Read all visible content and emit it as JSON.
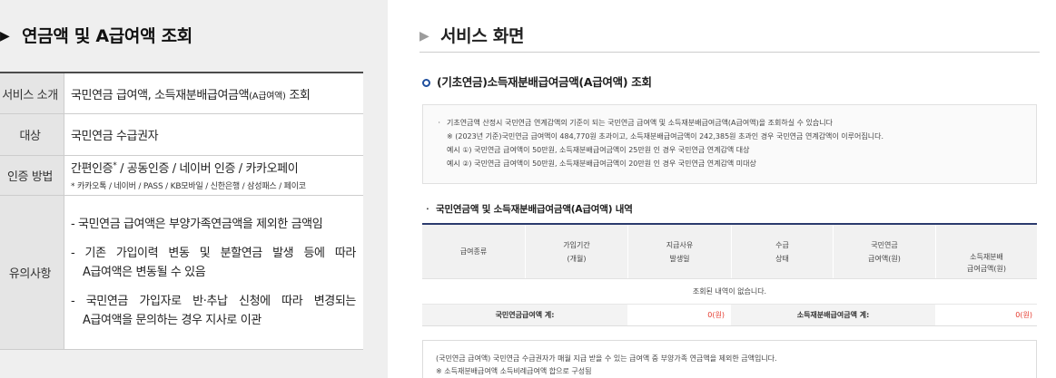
{
  "left": {
    "title_arrow": "▶",
    "title": "연금액 및 A급여액 조회",
    "table": {
      "intro": {
        "header": "서비스 소개",
        "text": "국민연금 급여액, 소득재분배급여금액",
        "text_small": "(A급여액)",
        "text_tail": "조회"
      },
      "target": {
        "header": "대상",
        "text": "국민연금 수급권자"
      },
      "auth": {
        "header": "인증 방법",
        "text": "간편인증",
        "mark": "*",
        "text_rest": " / 공동인증 / 네이버 인증 / 카카오페이",
        "note": "* 카카오톡 / 네이버 / PASS / KB모바일 / 신한은행 / 삼성패스 / 페이코"
      },
      "notes": {
        "header": "유의사항",
        "items": [
          {
            "lines": [
              "- 국민연금 급여액은 부양가족연금액을 제외한 금액임"
            ]
          },
          {
            "lines": [
              "- 기존 가입이력 변동 및 분할연금 발생 등에 따라",
              "A급여액은 변동될 수 있음"
            ]
          },
          {
            "lines": [
              "- 국민연금 가입자로 반·추납 신청에 따라 변경되는",
              "A급여액을 문의하는 경우 지사로 이관"
            ]
          }
        ]
      }
    }
  },
  "right": {
    "title_arrow": "▶",
    "title": "서비스 화면",
    "section1_title": "(기초연금)소득재분배급여금액(A급여액) 조회",
    "info_box": {
      "bullet": "ㆍ",
      "lines": [
        "기초연금액 산정시 국민연금 연계감액의 기준이 되는 국민연금 급여액 및 소득재분배급여금액(A급여액)을 조회하실 수 있습니다",
        "※ (2023년 기준)국민연금 급여액이 484,770원 초과이고, 소득재분배급여금액이 242,385원 초과인 경우 국민연금 연계감액이 이루어집니다.",
        "예시 ①) 국민연금 급여액이 50만원, 소득재분배급여금액이 25만원 인 경우 국민연금 연계감액 대상",
        "예시 ②) 국민연금 급여액이 50만원, 소득재분배급여금액이 20만원 인 경우 국민연금 연계감액 미대상"
      ]
    },
    "section2": {
      "bullet": "ㆍ",
      "title": "국민연금액 및 소득재분배급여금액(A급여액) 내역"
    },
    "table": {
      "headers": [
        {
          "lines": [
            "급여종류"
          ]
        },
        {
          "lines": [
            "가입기간",
            "(개월)"
          ]
        },
        {
          "lines": [
            "지급사유",
            "발생일"
          ]
        },
        {
          "lines": [
            "수급",
            "상태"
          ]
        },
        {
          "lines": [
            "국민연금",
            "급여액(원)"
          ]
        },
        {
          "lines": [
            "소득재분배",
            "급여금액(원)"
          ]
        }
      ],
      "empty_message": "조회된 내역이 없습니다.",
      "totals": [
        {
          "label": "국민연금급여액 계:",
          "value": "0(원)"
        },
        {
          "label": "소득재분배급여금액 계:",
          "value": "0(원)"
        }
      ]
    },
    "footnote_box": {
      "lines": [
        "(국민연금 급여액) 국민연금 수급권자가 매월 지급 받을 수 있는 급여액 중 부양가족 연금액을 제외한 금액입니다.",
        "※ 소득재분배급여액 소득비례급여액 합으로 구성됨"
      ]
    }
  },
  "colors": {
    "left_panel_background": "#efefef",
    "table_top_border": "#2b3b6e",
    "section_icon": "#1f4f9e",
    "total_value": "#e5392d",
    "right_title_arrow": "#9c9c9c"
  }
}
